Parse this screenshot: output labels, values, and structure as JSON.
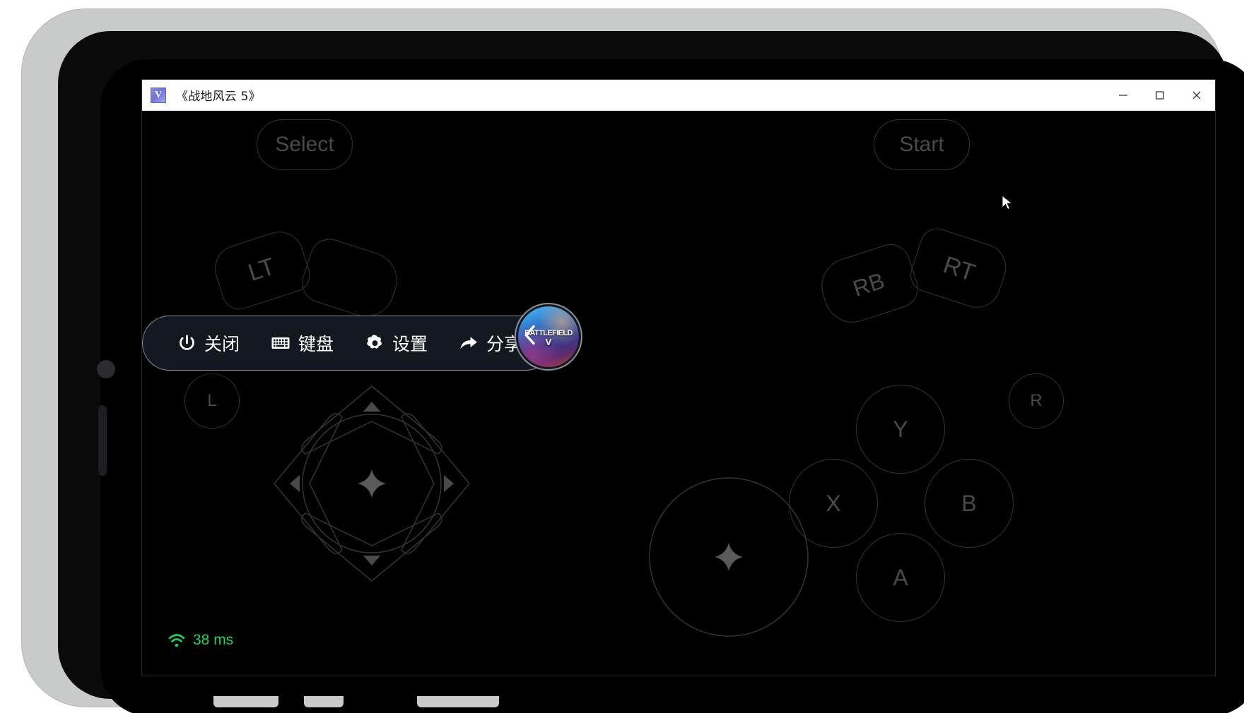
{
  "window": {
    "app_icon_letter": "V",
    "title": "《战地风云 5》",
    "controls": [
      {
        "name": "minimize",
        "glyph": "─"
      },
      {
        "name": "maximize",
        "glyph": "□"
      },
      {
        "name": "close",
        "glyph": "✕"
      }
    ]
  },
  "toolbar": {
    "items": [
      {
        "id": "power",
        "icon": "power-icon",
        "label": "关闭"
      },
      {
        "id": "keyboard",
        "icon": "keyboard-icon",
        "label": "键盘"
      },
      {
        "id": "settings",
        "icon": "gear-icon",
        "label": "设置"
      },
      {
        "id": "share",
        "icon": "share-icon",
        "label": "分享"
      }
    ],
    "collapse_icon": "chevron-left-icon",
    "thumbnail": {
      "icon": "game-thumbnail",
      "line1": "BATTLEFIELD",
      "line2": "V"
    }
  },
  "gamepad": {
    "select": "Select",
    "start": "Start",
    "shoulders": [
      {
        "id": "lt",
        "label": "LT"
      },
      {
        "id": "lb",
        "label": ""
      },
      {
        "id": "rb",
        "label": "RB"
      },
      {
        "id": "rt",
        "label": "RT"
      }
    ],
    "triggers": [
      {
        "id": "l",
        "label": "L"
      },
      {
        "id": "r",
        "label": "R"
      }
    ],
    "face_buttons": [
      {
        "id": "y",
        "label": "Y"
      },
      {
        "id": "x",
        "label": "X"
      },
      {
        "id": "b",
        "label": "B"
      },
      {
        "id": "a",
        "label": "A"
      }
    ],
    "dpad": {
      "up": "▲",
      "down": "▼",
      "left": "◀",
      "right": "▶",
      "center_icon": "four-point-star-icon"
    },
    "right_stick": {
      "center_icon": "four-point-star-icon"
    }
  },
  "status": {
    "network_icon": "wifi-icon",
    "latency": "38 ms",
    "latency_color": "#17d65a"
  }
}
